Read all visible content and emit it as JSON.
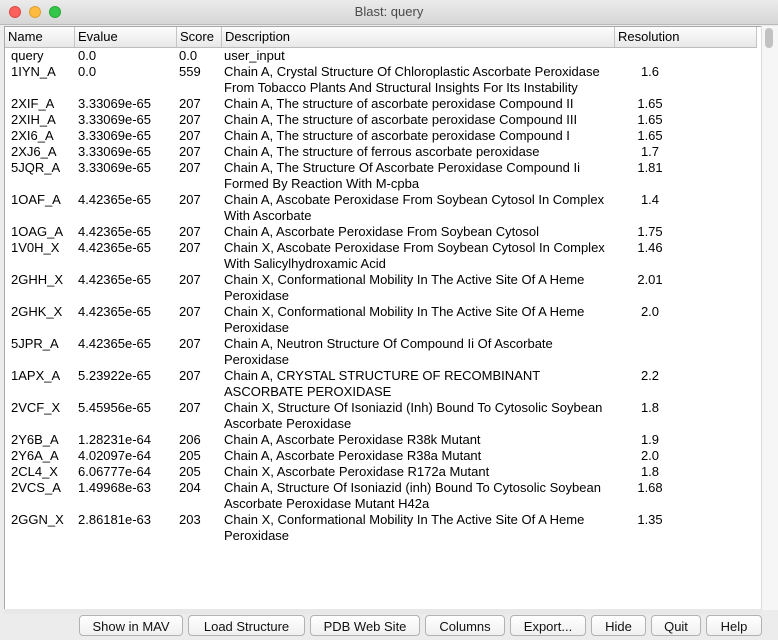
{
  "window": {
    "title": "Blast: query"
  },
  "table": {
    "headers": {
      "name": "Name",
      "evalue": "Evalue",
      "score": "Score",
      "description": "Description",
      "resolution": "Resolution"
    },
    "rows": [
      {
        "name": "query",
        "evalue": "0.0",
        "score": "0.0",
        "description": "user_input",
        "resolution": ""
      },
      {
        "name": "1IYN_A",
        "evalue": "0.0",
        "score": "559",
        "description": "Chain A, Crystal Structure Of Chloroplastic Ascorbate Peroxidase From Tobacco Plants And Structural Insights For Its Instability",
        "resolution": "1.6"
      },
      {
        "name": "2XIF_A",
        "evalue": "3.33069e-65",
        "score": "207",
        "description": "Chain A, The structure of ascorbate peroxidase Compound II",
        "resolution": "1.65"
      },
      {
        "name": "2XIH_A",
        "evalue": "3.33069e-65",
        "score": "207",
        "description": "Chain A, The structure of ascorbate peroxidase Compound III",
        "resolution": "1.65"
      },
      {
        "name": "2XI6_A",
        "evalue": "3.33069e-65",
        "score": "207",
        "description": "Chain A, The structure of ascorbate peroxidase Compound I",
        "resolution": "1.65"
      },
      {
        "name": "2XJ6_A",
        "evalue": "3.33069e-65",
        "score": "207",
        "description": "Chain A, The structure of ferrous ascorbate peroxidase",
        "resolution": "1.7"
      },
      {
        "name": "5JQR_A",
        "evalue": "3.33069e-65",
        "score": "207",
        "description": "Chain A, The Structure Of Ascorbate Peroxidase Compound Ii Formed By Reaction With M-cpba",
        "resolution": "1.81"
      },
      {
        "name": "1OAF_A",
        "evalue": "4.42365e-65",
        "score": "207",
        "description": "Chain A, Ascobate Peroxidase From Soybean Cytosol In Complex With Ascorbate",
        "resolution": "1.4"
      },
      {
        "name": "1OAG_A",
        "evalue": "4.42365e-65",
        "score": "207",
        "description": "Chain A, Ascorbate Peroxidase From Soybean Cytosol",
        "resolution": "1.75"
      },
      {
        "name": "1V0H_X",
        "evalue": "4.42365e-65",
        "score": "207",
        "description": "Chain X, Ascobate Peroxidase From Soybean Cytosol In Complex With Salicylhydroxamic Acid",
        "resolution": "1.46"
      },
      {
        "name": "2GHH_X",
        "evalue": "4.42365e-65",
        "score": "207",
        "description": "Chain X, Conformational Mobility In The Active Site Of A Heme Peroxidase",
        "resolution": "2.01"
      },
      {
        "name": "2GHK_X",
        "evalue": "4.42365e-65",
        "score": "207",
        "description": "Chain X, Conformational Mobility In The Active Site Of A Heme Peroxidase",
        "resolution": "2.0"
      },
      {
        "name": "5JPR_A",
        "evalue": "4.42365e-65",
        "score": "207",
        "description": "Chain A, Neutron Structure Of Compound Ii Of Ascorbate Peroxidase",
        "resolution": ""
      },
      {
        "name": "1APX_A",
        "evalue": "5.23922e-65",
        "score": "207",
        "description": "Chain A, CRYSTAL STRUCTURE OF RECOMBINANT ASCORBATE PEROXIDASE",
        "resolution": "2.2"
      },
      {
        "name": "2VCF_X",
        "evalue": "5.45956e-65",
        "score": "207",
        "description": "Chain X, Structure Of Isoniazid (Inh) Bound To Cytosolic Soybean Ascorbate Peroxidase",
        "resolution": "1.8"
      },
      {
        "name": "2Y6B_A",
        "evalue": "1.28231e-64",
        "score": "206",
        "description": "Chain A, Ascorbate Peroxidase R38k Mutant",
        "resolution": "1.9"
      },
      {
        "name": "2Y6A_A",
        "evalue": "4.02097e-64",
        "score": "205",
        "description": "Chain A, Ascorbate Peroxidase R38a Mutant",
        "resolution": "2.0"
      },
      {
        "name": "2CL4_X",
        "evalue": "6.06777e-64",
        "score": "205",
        "description": "Chain X, Ascorbate Peroxidase R172a Mutant",
        "resolution": "1.8"
      },
      {
        "name": "2VCS_A",
        "evalue": "1.49968e-63",
        "score": "204",
        "description": "Chain A, Structure Of Isoniazid (inh) Bound To Cytosolic Soybean Ascorbate Peroxidase Mutant H42a",
        "resolution": "1.68"
      },
      {
        "name": "2GGN_X",
        "evalue": "2.86181e-63",
        "score": "203",
        "description": "Chain X, Conformational Mobility In The Active Site Of A Heme Peroxidase",
        "resolution": "1.35"
      }
    ]
  },
  "buttons": {
    "show_in_mav": "Show in MAV",
    "load_structure": "Load Structure",
    "pdb_web_site": "PDB Web Site",
    "columns": "Columns",
    "export": "Export...",
    "hide": "Hide",
    "quit": "Quit",
    "help": "Help"
  }
}
